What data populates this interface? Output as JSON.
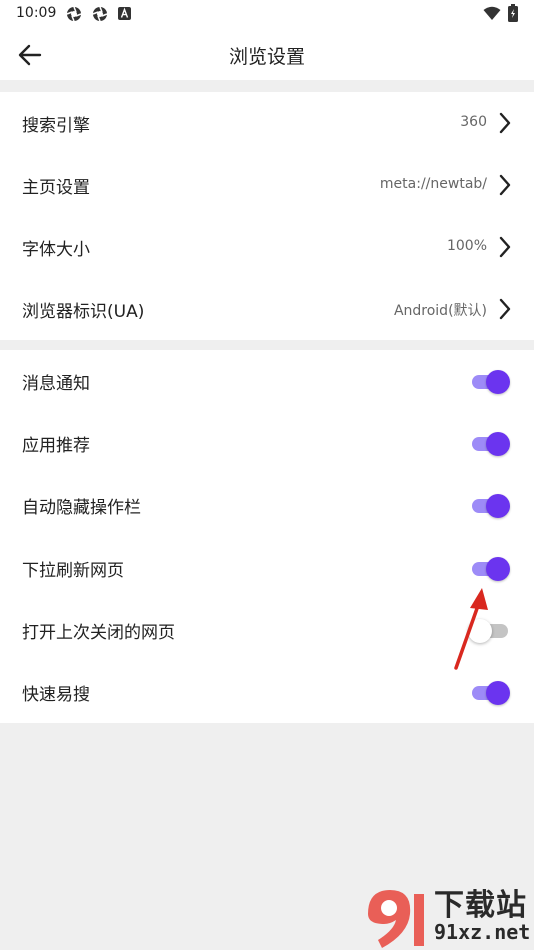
{
  "status": {
    "time": "10:09"
  },
  "appbar": {
    "title": "浏览设置"
  },
  "section1": [
    {
      "label": "搜索引擎",
      "value": "360"
    },
    {
      "label": "主页设置",
      "value": "meta://newtab/"
    },
    {
      "label": "字体大小",
      "value": "100%"
    },
    {
      "label": "浏览器标识(UA)",
      "value": "Android(默认)"
    }
  ],
  "section2": [
    {
      "label": "消息通知",
      "on": true
    },
    {
      "label": "应用推荐",
      "on": true
    },
    {
      "label": "自动隐藏操作栏",
      "on": true
    },
    {
      "label": "下拉刷新网页",
      "on": true
    },
    {
      "label": "打开上次关闭的网页",
      "on": false
    },
    {
      "label": "快速易搜",
      "on": true
    }
  ],
  "watermark": {
    "title": "下载站",
    "sub": "91xz.net"
  },
  "colors": {
    "accent": "#6b34ef",
    "accent_track": "#9d8bf7",
    "annotation": "#d9281f"
  }
}
